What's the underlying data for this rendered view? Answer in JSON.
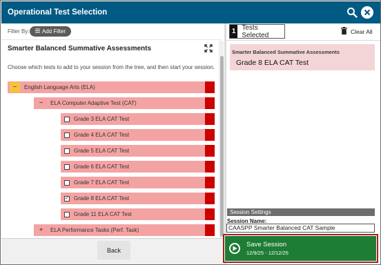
{
  "window": {
    "title": "Operational  Test Selection"
  },
  "colors": {
    "header": "#005a84",
    "row_fill": "#f4a3a3",
    "row_tail": "#cc0000",
    "highlight": "#f5c33b",
    "selected_card": "#f4d5d7",
    "save_button": "#1e7d34"
  },
  "icons": {
    "search": "search-icon",
    "close": "close-icon",
    "expand": "expand-icon",
    "trash": "trash-icon",
    "play": "play-icon",
    "filter": "filter-icon"
  },
  "filter": {
    "label": "Filter By:",
    "button": "Add Filter"
  },
  "left": {
    "heading": "Smarter Balanced Summative Assessments",
    "instructions": "Choose which tests to add to your session from the tree, and then start your session."
  },
  "tree": [
    {
      "level": 0,
      "toggle": "−",
      "label": "English Language Arts (ELA)"
    },
    {
      "level": 1,
      "toggle": "−",
      "label": "ELA Computer Adaptive Test (CAT)"
    },
    {
      "level": 2,
      "checked": false,
      "label": "Grade 3 ELA CAT Test"
    },
    {
      "level": 2,
      "checked": false,
      "label": "Grade 4 ELA CAT Test"
    },
    {
      "level": 2,
      "checked": false,
      "label": "Grade 5 ELA CAT Test"
    },
    {
      "level": 2,
      "checked": false,
      "label": "Grade 6 ELA CAT Test"
    },
    {
      "level": 2,
      "checked": false,
      "label": "Grade 7 ELA CAT Test"
    },
    {
      "level": 2,
      "checked": true,
      "label": "Grade 8 ELA CAT Test"
    },
    {
      "level": 2,
      "checked": false,
      "label": "Grade 11 ELA CAT Test"
    },
    {
      "level": 1,
      "toggle": "+",
      "label": "ELA Performance Tasks (Perf. Task)"
    }
  ],
  "footer": {
    "back": "Back"
  },
  "right": {
    "count": "1",
    "selected_label": "Tests Selected",
    "clear_all": "Clear All",
    "selected_category": "Smarter Balanced Summative Assessments",
    "selected_item": "Grade 8 ELA CAT Test",
    "session_settings": "Session Settings",
    "session_name_label": "Session Name:",
    "session_name_value": "CAASPP Smarter Balanced CAT Sample",
    "save_label": "Save Session",
    "save_dates": "12/9/25 - 12/12/25"
  }
}
